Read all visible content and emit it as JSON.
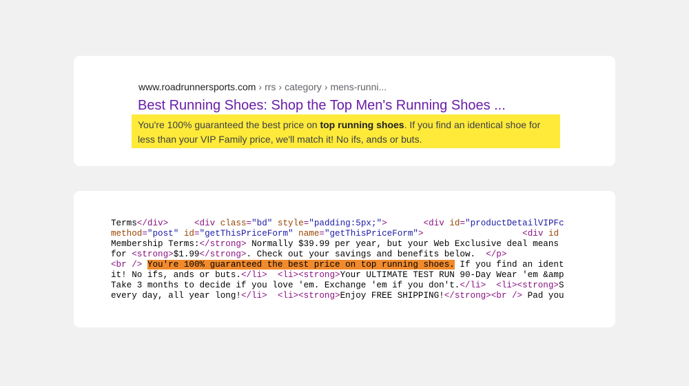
{
  "serp": {
    "breadcrumb": {
      "domain": "www.roadrunnersports.com",
      "parts": [
        "rrs",
        "category",
        "mens-runni..."
      ],
      "separator": "›"
    },
    "title": "Best Running Shoes: Shop the Top Men's Running Shoes ...",
    "snippet": {
      "before": "You're 100% guaranteed the best price on ",
      "bold": "top running shoes",
      "after": ". If you find an identical shoe for less than your VIP Family price, we'll match it! No ifs, ands or buts."
    },
    "colors": {
      "title": "#681da8",
      "highlight": "#ffea3a"
    }
  },
  "source_code": {
    "highlight_color": "#f08a2c",
    "lines": [
      [
        {
          "t": "txt",
          "v": "Terms"
        },
        {
          "t": "tag",
          "v": "</div>"
        },
        {
          "t": "txt",
          "v": "     "
        },
        {
          "t": "tag",
          "v": "<div "
        },
        {
          "t": "attr",
          "v": "class"
        },
        {
          "t": "tag",
          "v": "="
        },
        {
          "t": "val",
          "v": "\"bd\""
        },
        {
          "t": "txt",
          "v": " "
        },
        {
          "t": "attr",
          "v": "style"
        },
        {
          "t": "tag",
          "v": "="
        },
        {
          "t": "val",
          "v": "\"padding:5px;\""
        },
        {
          "t": "tag",
          "v": ">"
        },
        {
          "t": "txt",
          "v": "       "
        },
        {
          "t": "tag",
          "v": "<div "
        },
        {
          "t": "attr",
          "v": "id"
        },
        {
          "t": "tag",
          "v": "="
        },
        {
          "t": "val",
          "v": "\"productDetailVIPFc"
        }
      ],
      [
        {
          "t": "attr",
          "v": "method"
        },
        {
          "t": "tag",
          "v": "="
        },
        {
          "t": "val",
          "v": "\"post\""
        },
        {
          "t": "txt",
          "v": " "
        },
        {
          "t": "attr",
          "v": "id"
        },
        {
          "t": "tag",
          "v": "="
        },
        {
          "t": "val",
          "v": "\"getThisPriceForm\""
        },
        {
          "t": "txt",
          "v": " "
        },
        {
          "t": "attr",
          "v": "name"
        },
        {
          "t": "tag",
          "v": "="
        },
        {
          "t": "val",
          "v": "\"getThisPriceForm\""
        },
        {
          "t": "tag",
          "v": ">"
        },
        {
          "t": "txt",
          "v": "                   "
        },
        {
          "t": "tag",
          "v": "<div "
        },
        {
          "t": "attr",
          "v": "id"
        }
      ],
      [
        {
          "t": "txt",
          "v": "Membership Terms:"
        },
        {
          "t": "tag",
          "v": "</strong>"
        },
        {
          "t": "txt",
          "v": " Normally $39.99 per year, but your Web Exclusive deal means"
        }
      ],
      [
        {
          "t": "txt",
          "v": "for "
        },
        {
          "t": "tag",
          "v": "<strong>"
        },
        {
          "t": "txt",
          "v": "$1.99"
        },
        {
          "t": "tag",
          "v": "</strong>"
        },
        {
          "t": "txt",
          "v": ". Check out your savings and benefits below.  "
        },
        {
          "t": "tag",
          "v": "</p>"
        }
      ],
      [
        {
          "t": "tag",
          "v": "<br />"
        },
        {
          "t": "txt",
          "v": " "
        },
        {
          "t": "hl",
          "v": "You're 100% guaranteed the best price on top running shoes."
        },
        {
          "t": "txt",
          "v": " If you find an ident"
        }
      ],
      [
        {
          "t": "txt",
          "v": "it! No ifs, ands or buts."
        },
        {
          "t": "tag",
          "v": "</li>"
        },
        {
          "t": "txt",
          "v": "  "
        },
        {
          "t": "tag",
          "v": "<li>"
        },
        {
          "t": "tag",
          "v": "<strong>"
        },
        {
          "t": "txt",
          "v": "Your ULTIMATE TEST RUN 90-Day Wear 'em &amp"
        }
      ],
      [
        {
          "t": "txt",
          "v": "Take 3 months to decide if you love 'em. Exchange 'em if you don't."
        },
        {
          "t": "tag",
          "v": "</li>"
        },
        {
          "t": "txt",
          "v": "  "
        },
        {
          "t": "tag",
          "v": "<li>"
        },
        {
          "t": "tag",
          "v": "<strong>"
        },
        {
          "t": "txt",
          "v": "S"
        }
      ],
      [
        {
          "t": "txt",
          "v": "every day, all year long!"
        },
        {
          "t": "tag",
          "v": "</li>"
        },
        {
          "t": "txt",
          "v": "  "
        },
        {
          "t": "tag",
          "v": "<li>"
        },
        {
          "t": "tag",
          "v": "<strong>"
        },
        {
          "t": "txt",
          "v": "Enjoy FREE SHIPPING!"
        },
        {
          "t": "tag",
          "v": "</strong>"
        },
        {
          "t": "tag",
          "v": "<br />"
        },
        {
          "t": "txt",
          "v": " Pad you"
        }
      ]
    ]
  }
}
